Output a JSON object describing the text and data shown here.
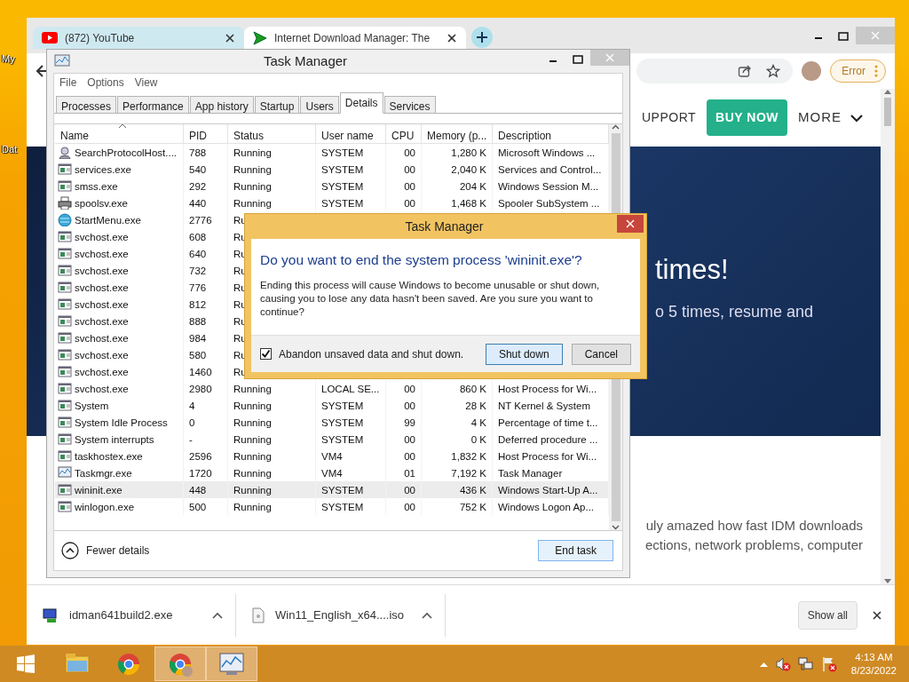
{
  "desktop": {
    "icon_labels": [
      "My",
      "Dat"
    ]
  },
  "browser": {
    "tabs": [
      {
        "title": "(872) YouTube",
        "kind": "youtube",
        "selected": false
      },
      {
        "title": "Internet Download Manager: The",
        "kind": "idm",
        "selected": true
      }
    ],
    "profile_button": "Error",
    "page": {
      "nav_link": "UPPORT",
      "buy_button": "BUY NOW",
      "more_menu": "MORE",
      "hero_title": "times!",
      "hero_subtitle": "o 5 times, resume and",
      "body_lines": [
        "uly amazed how fast IDM downloads",
        "ections, network problems, computer"
      ]
    },
    "downloads": [
      {
        "name": "idman641build2.exe",
        "kind": "exe"
      },
      {
        "name": "Win11_English_x64....iso",
        "kind": "file"
      }
    ],
    "show_all": "Show all"
  },
  "task_manager": {
    "title": "Task Manager",
    "menu": [
      "File",
      "Options",
      "View"
    ],
    "tabs": [
      {
        "label": "Processes",
        "selected": false
      },
      {
        "label": "Performance",
        "selected": false
      },
      {
        "label": "App history",
        "selected": false
      },
      {
        "label": "Startup",
        "selected": false
      },
      {
        "label": "Users",
        "selected": false
      },
      {
        "label": "Details",
        "selected": true
      },
      {
        "label": "Services",
        "selected": false
      }
    ],
    "columns": [
      {
        "label": "Name",
        "sorted": true
      },
      {
        "label": "PID",
        "sorted": false
      },
      {
        "label": "Status",
        "sorted": false
      },
      {
        "label": "User name",
        "sorted": false
      },
      {
        "label": "CPU",
        "sorted": false
      },
      {
        "label": "Memory (p...",
        "sorted": false
      },
      {
        "label": "Description",
        "sorted": false
      }
    ],
    "rows": [
      {
        "kind": "search",
        "selected": false,
        "cells": [
          "SearchProtocolHost....",
          "788",
          "Running",
          "SYSTEM",
          "00",
          "1,280 K",
          "Microsoft Windows ..."
        ]
      },
      {
        "kind": "window",
        "selected": false,
        "cells": [
          "services.exe",
          "540",
          "Running",
          "SYSTEM",
          "00",
          "2,040 K",
          "Services and Control..."
        ]
      },
      {
        "kind": "window",
        "selected": false,
        "cells": [
          "smss.exe",
          "292",
          "Running",
          "SYSTEM",
          "00",
          "204 K",
          "Windows Session M..."
        ]
      },
      {
        "kind": "printer",
        "selected": false,
        "cells": [
          "spoolsv.exe",
          "440",
          "Running",
          "SYSTEM",
          "00",
          "1,468 K",
          "Spooler SubSystem ..."
        ]
      },
      {
        "kind": "globe",
        "selected": false,
        "cells": [
          "StartMenu.exe",
          "2776",
          "Ru"
        ]
      },
      {
        "kind": "window",
        "selected": false,
        "cells": [
          "svchost.exe",
          "608",
          "Ru"
        ]
      },
      {
        "kind": "window",
        "selected": false,
        "cells": [
          "svchost.exe",
          "640",
          "Ru"
        ]
      },
      {
        "kind": "window",
        "selected": false,
        "cells": [
          "svchost.exe",
          "732",
          "Ru"
        ]
      },
      {
        "kind": "window",
        "selected": false,
        "cells": [
          "svchost.exe",
          "776",
          "Ru"
        ]
      },
      {
        "kind": "window",
        "selected": false,
        "cells": [
          "svchost.exe",
          "812",
          "Ru"
        ]
      },
      {
        "kind": "window",
        "selected": false,
        "cells": [
          "svchost.exe",
          "888",
          "Ru"
        ]
      },
      {
        "kind": "window",
        "selected": false,
        "cells": [
          "svchost.exe",
          "984",
          "Ru"
        ]
      },
      {
        "kind": "window",
        "selected": false,
        "cells": [
          "svchost.exe",
          "580",
          "Ru"
        ]
      },
      {
        "kind": "window",
        "selected": false,
        "cells": [
          "svchost.exe",
          "1460",
          "Ru"
        ]
      },
      {
        "kind": "window",
        "selected": false,
        "cells": [
          "svchost.exe",
          "2980",
          "Running",
          "LOCAL SE...",
          "00",
          "860 K",
          "Host Process for Wi..."
        ]
      },
      {
        "kind": "window",
        "selected": false,
        "cells": [
          "System",
          "4",
          "Running",
          "SYSTEM",
          "00",
          "28 K",
          "NT Kernel & System"
        ]
      },
      {
        "kind": "window",
        "selected": false,
        "cells": [
          "System Idle Process",
          "0",
          "Running",
          "SYSTEM",
          "99",
          "4 K",
          "Percentage of time t..."
        ]
      },
      {
        "kind": "window",
        "selected": false,
        "cells": [
          "System interrupts",
          "-",
          "Running",
          "SYSTEM",
          "00",
          "0 K",
          "Deferred procedure ..."
        ]
      },
      {
        "kind": "window",
        "selected": false,
        "cells": [
          "taskhostex.exe",
          "2596",
          "Running",
          "VM4",
          "00",
          "1,832 K",
          "Host Process for Wi..."
        ]
      },
      {
        "kind": "monitor",
        "selected": false,
        "cells": [
          "Taskmgr.exe",
          "1720",
          "Running",
          "VM4",
          "01",
          "7,192 K",
          "Task Manager"
        ]
      },
      {
        "kind": "window",
        "selected": true,
        "cells": [
          "wininit.exe",
          "448",
          "Running",
          "SYSTEM",
          "00",
          "436 K",
          "Windows Start-Up A..."
        ]
      },
      {
        "kind": "window",
        "selected": false,
        "cells": [
          "winlogon.exe",
          "500",
          "Running",
          "SYSTEM",
          "00",
          "752 K",
          "Windows Logon Ap..."
        ]
      }
    ],
    "fewer_details": "Fewer details",
    "end_task": "End task"
  },
  "dialog": {
    "title": "Task Manager",
    "heading": "Do you want to end the system process 'wininit.exe'?",
    "message": "Ending this process will cause Windows to become unusable or shut down, causing you to lose any data hasn't been saved. Are you sure you want to continue?",
    "checkbox": {
      "label": "Abandon unsaved data and shut down.",
      "checked": true
    },
    "buttons": [
      {
        "label": "Shut down",
        "default": true
      },
      {
        "label": "Cancel",
        "default": false
      }
    ]
  },
  "taskbar": {
    "apps": [
      {
        "kind": "explorer",
        "active": false
      },
      {
        "kind": "chrome",
        "active": false
      },
      {
        "kind": "chrome-profile",
        "active": true
      },
      {
        "kind": "taskmgr",
        "active": true
      }
    ],
    "time": "4:13 AM",
    "date": "8/23/2022"
  }
}
